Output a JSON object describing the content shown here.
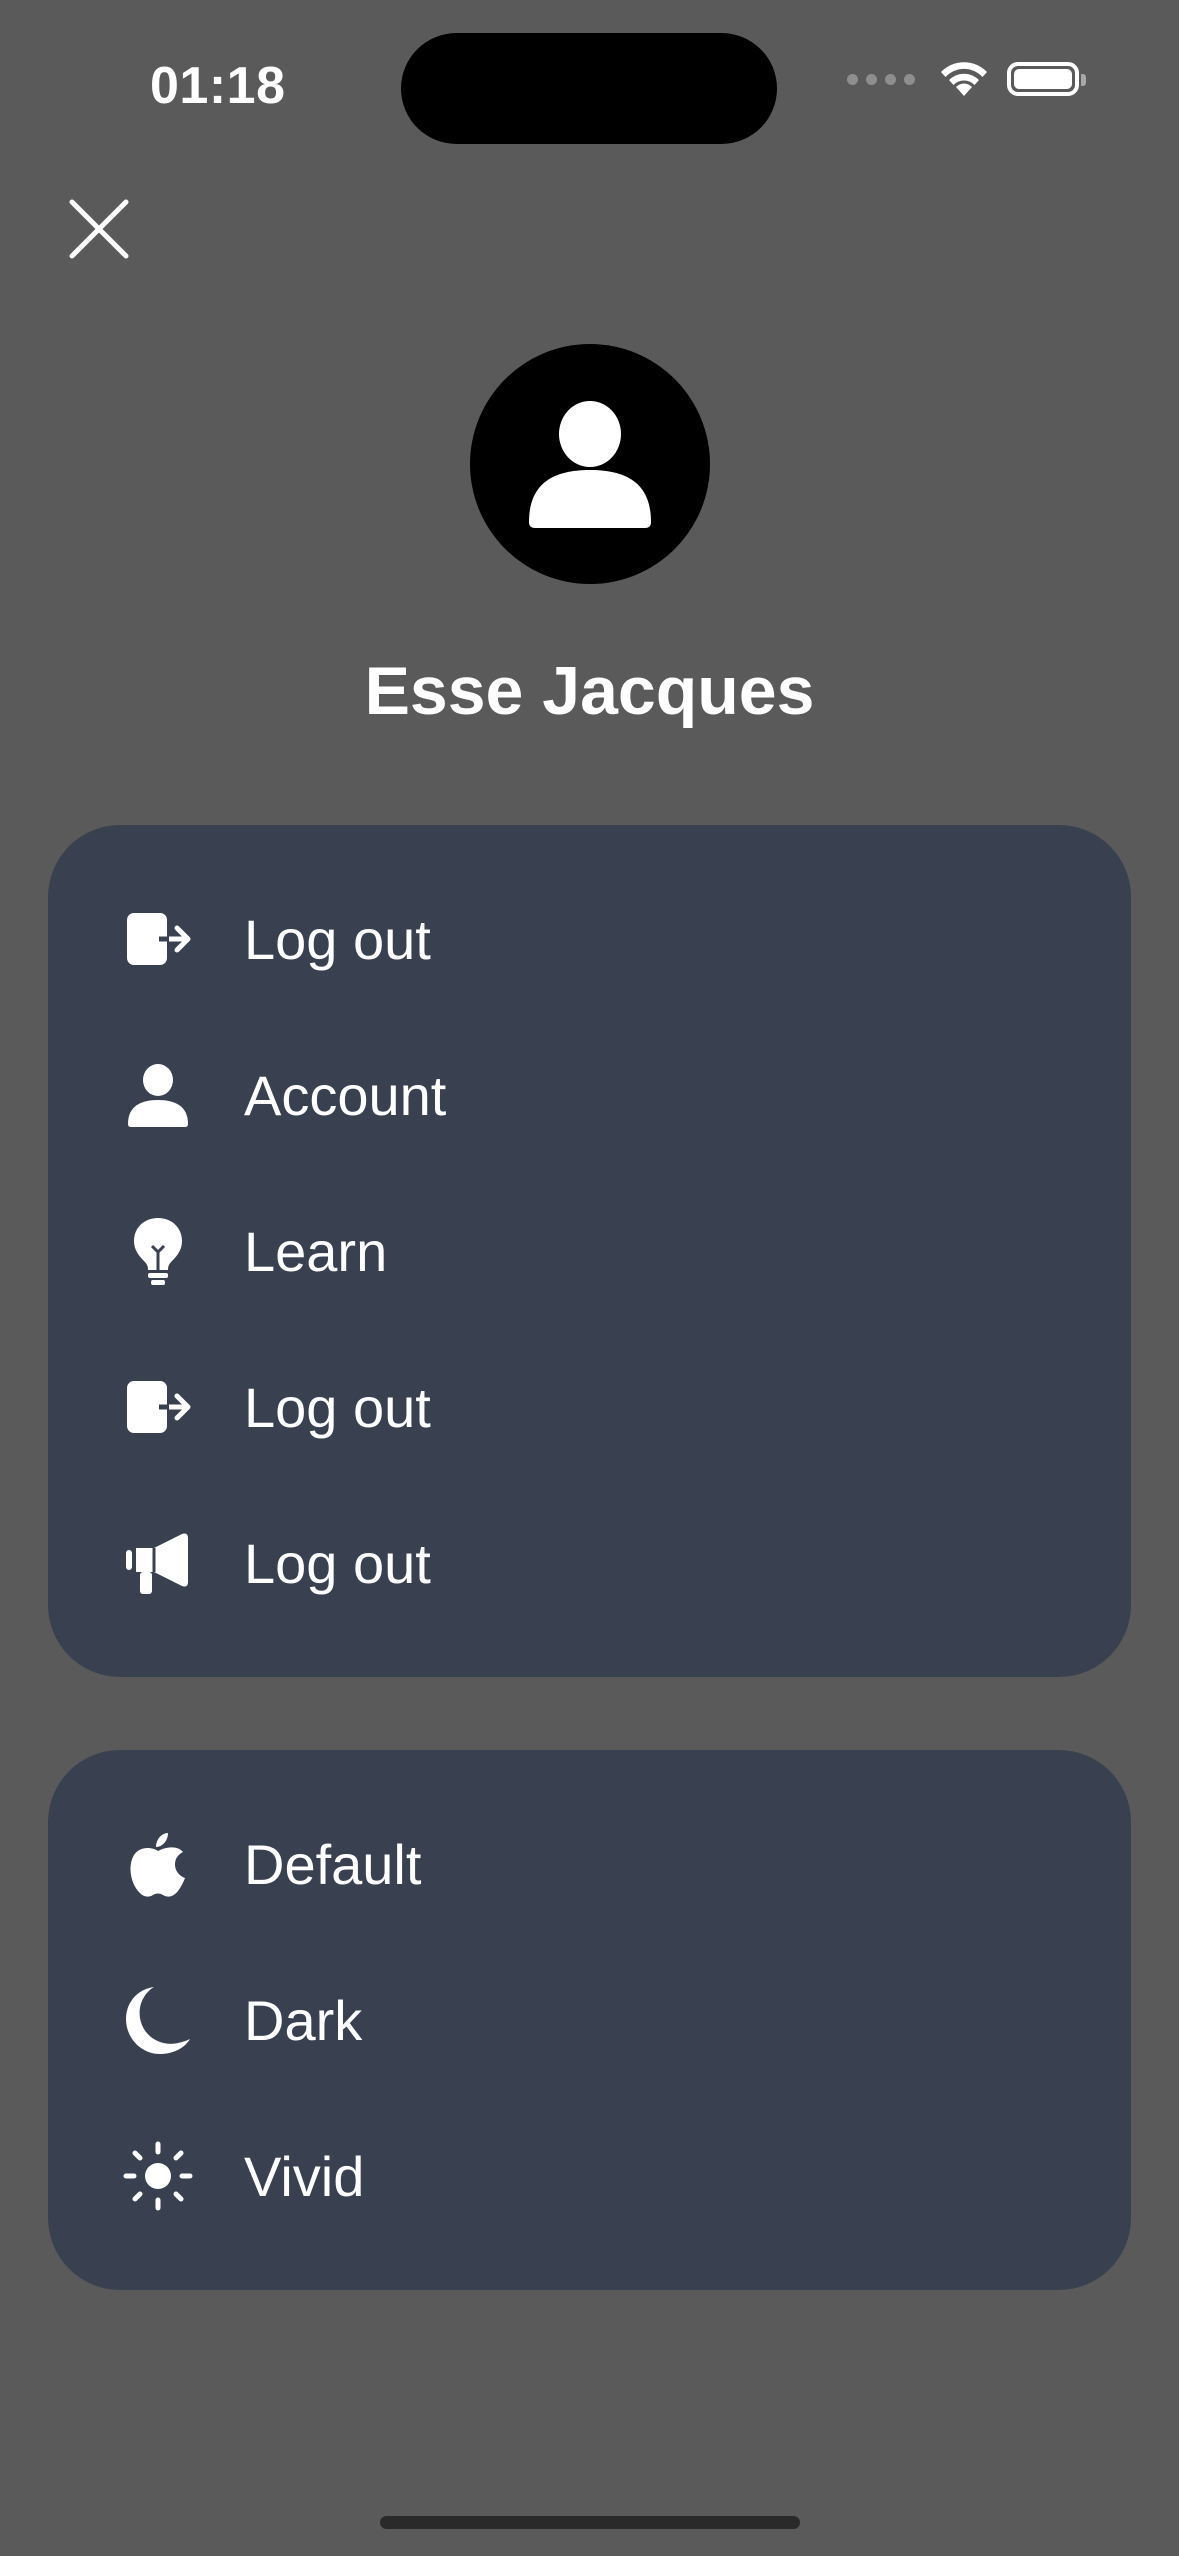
{
  "status_bar": {
    "time": "01:18"
  },
  "profile": {
    "name": "Esse Jacques"
  },
  "menu_primary": [
    {
      "label": "Log out",
      "icon": "logout-icon"
    },
    {
      "label": "Account",
      "icon": "person-icon"
    },
    {
      "label": "Learn",
      "icon": "lightbulb-icon"
    },
    {
      "label": "Log out",
      "icon": "logout-icon"
    },
    {
      "label": "Log out",
      "icon": "megaphone-icon"
    }
  ],
  "menu_theme": [
    {
      "label": "Default",
      "icon": "apple-icon"
    },
    {
      "label": "Dark",
      "icon": "moon-icon"
    },
    {
      "label": "Vivid",
      "icon": "sun-icon"
    }
  ],
  "colors": {
    "background": "#5a5a5a",
    "card": "#394151",
    "text": "#ffffff"
  }
}
